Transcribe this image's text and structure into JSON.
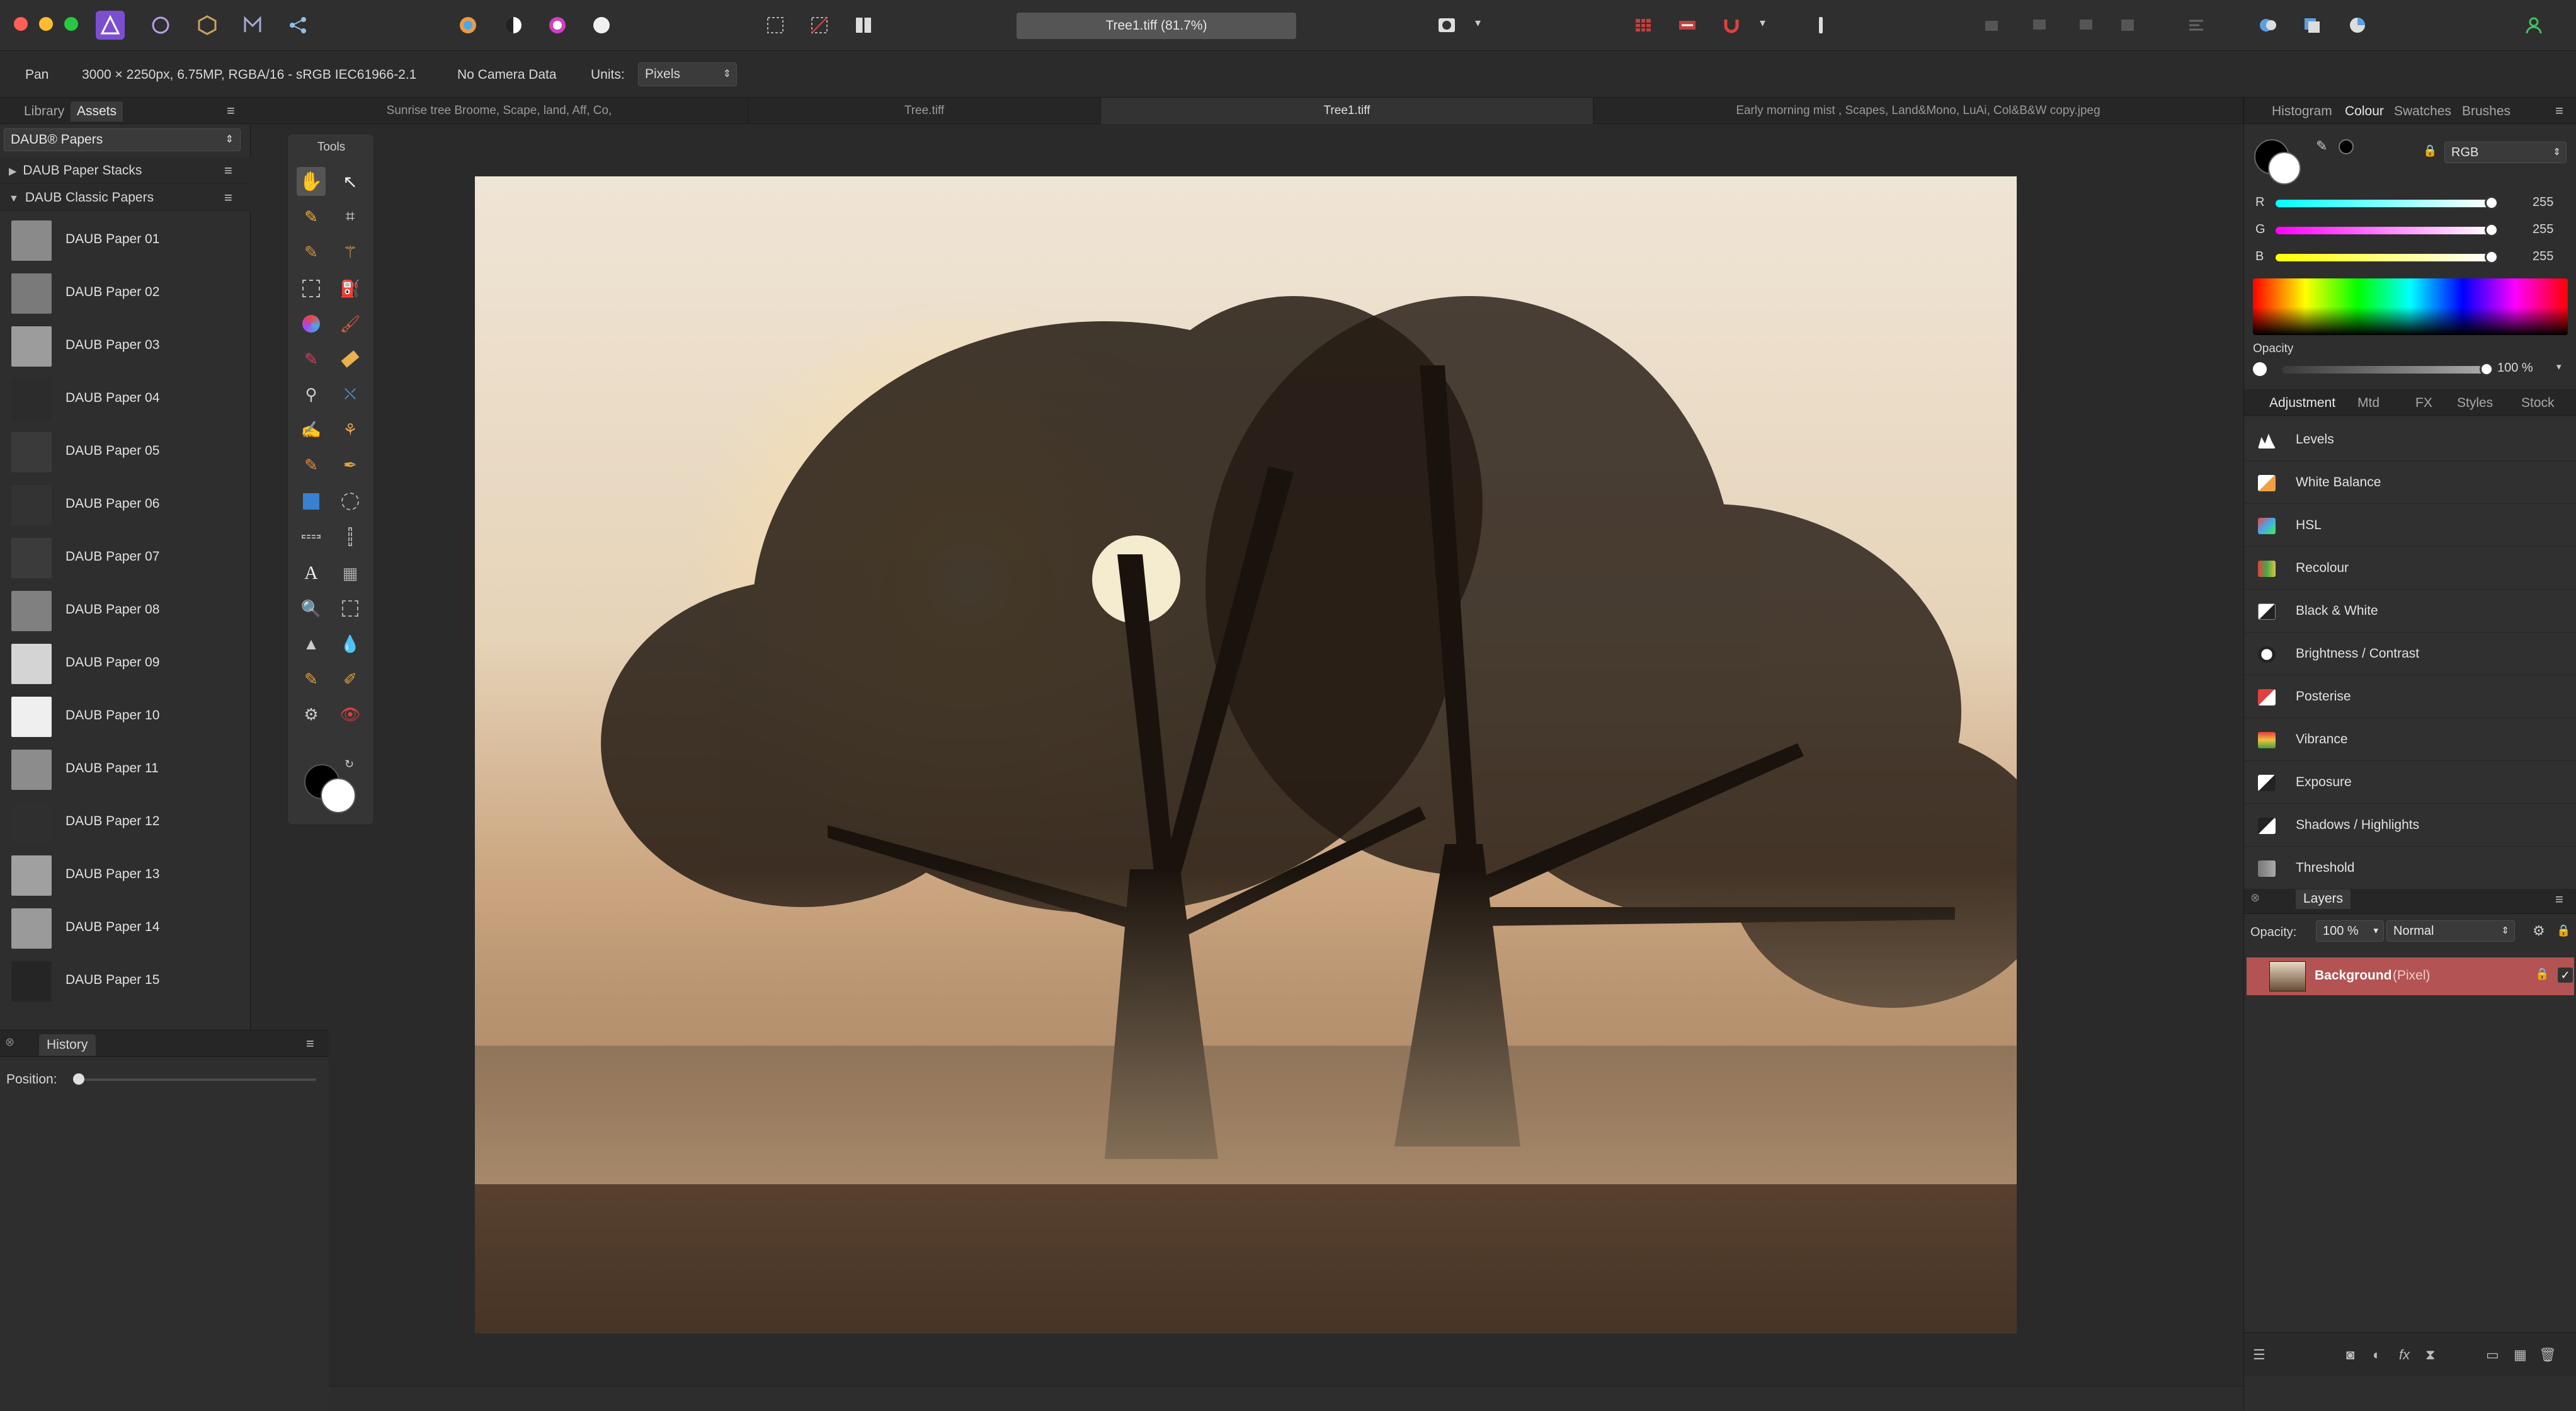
{
  "window": {
    "title": "Tree1.tiff (81.7%)"
  },
  "context": {
    "tool": "Pan",
    "doc_info": "3000 × 2250px, 6.75MP, RGBA/16 - sRGB IEC61966-2.1",
    "camera": "No Camera Data",
    "units_label": "Units:",
    "units_value": "Pixels"
  },
  "left_panel": {
    "tabs": [
      "Library",
      "Assets"
    ],
    "category": "DAUB® Papers",
    "groups": [
      "DAUB Paper Stacks",
      "DAUB Classic Papers"
    ],
    "papers": [
      "DAUB Paper 01",
      "DAUB Paper 02",
      "DAUB Paper 03",
      "DAUB Paper 04",
      "DAUB Paper 05",
      "DAUB Paper 06",
      "DAUB Paper 07",
      "DAUB Paper 08",
      "DAUB Paper 09",
      "DAUB Paper 10",
      "DAUB Paper 11",
      "DAUB Paper 12",
      "DAUB Paper 13",
      "DAUB Paper 14",
      "DAUB Paper 15"
    ],
    "paper_colors": [
      "#8a8a8a",
      "#7a7a7a",
      "#9c9c9c",
      "#2c2c2c",
      "#3a3a3a",
      "#333333",
      "#3b3b3b",
      "#808080",
      "#d4d4d4",
      "#efefef",
      "#8c8c8c",
      "#2f2f2f",
      "#a0a0a0",
      "#9a9a9a",
      "#252525"
    ]
  },
  "history": {
    "tab": "History",
    "position_label": "Position:"
  },
  "tools": {
    "title": "Tools"
  },
  "doc_tabs": [
    "Sunrise tree Broome, Scape, land, Aff, Co,",
    "Tree.tiff",
    "Tree1.tiff",
    "Early morning mist , Scapes, Land&Mono, LuAi, Col&B&W copy.jpeg"
  ],
  "right_panel": {
    "top_tabs": [
      "Histogram",
      "Colour",
      "Swatches",
      "Brushes"
    ],
    "color_model": "RGB",
    "channels": [
      {
        "name": "R",
        "value": "255",
        "gradient": "linear-gradient(to right,#00ffff,#ffffff)"
      },
      {
        "name": "G",
        "value": "255",
        "gradient": "linear-gradient(to right,#ff00ff,#ffffff)"
      },
      {
        "name": "B",
        "value": "255",
        "gradient": "linear-gradient(to right,#ffff00,#ffffff)"
      }
    ],
    "opacity_label": "Opacity",
    "opacity_value": "100 %",
    "adj_tabs": [
      "Adjustment",
      "Mtd",
      "FX",
      "Styles",
      "Stock"
    ],
    "adjustments": [
      {
        "label": "Levels",
        "icon": "levels-icon"
      },
      {
        "label": "White Balance",
        "icon": "white-balance-icon"
      },
      {
        "label": "HSL",
        "icon": "hsl-icon"
      },
      {
        "label": "Recolour",
        "icon": "recolour-icon"
      },
      {
        "label": "Black & White",
        "icon": "black-white-icon"
      },
      {
        "label": "Brightness / Contrast",
        "icon": "brightness-contrast-icon"
      },
      {
        "label": "Posterise",
        "icon": "posterise-icon"
      },
      {
        "label": "Vibrance",
        "icon": "vibrance-icon"
      },
      {
        "label": "Exposure",
        "icon": "exposure-icon"
      },
      {
        "label": "Shadows / Highlights",
        "icon": "shadows-highlights-icon"
      },
      {
        "label": "Threshold",
        "icon": "threshold-icon"
      }
    ],
    "layers": {
      "tab": "Layers",
      "opacity_label": "Opacity:",
      "opacity_value": "100 %",
      "blend_mode": "Normal",
      "layer_name": "Background",
      "layer_type": "(Pixel)"
    }
  }
}
